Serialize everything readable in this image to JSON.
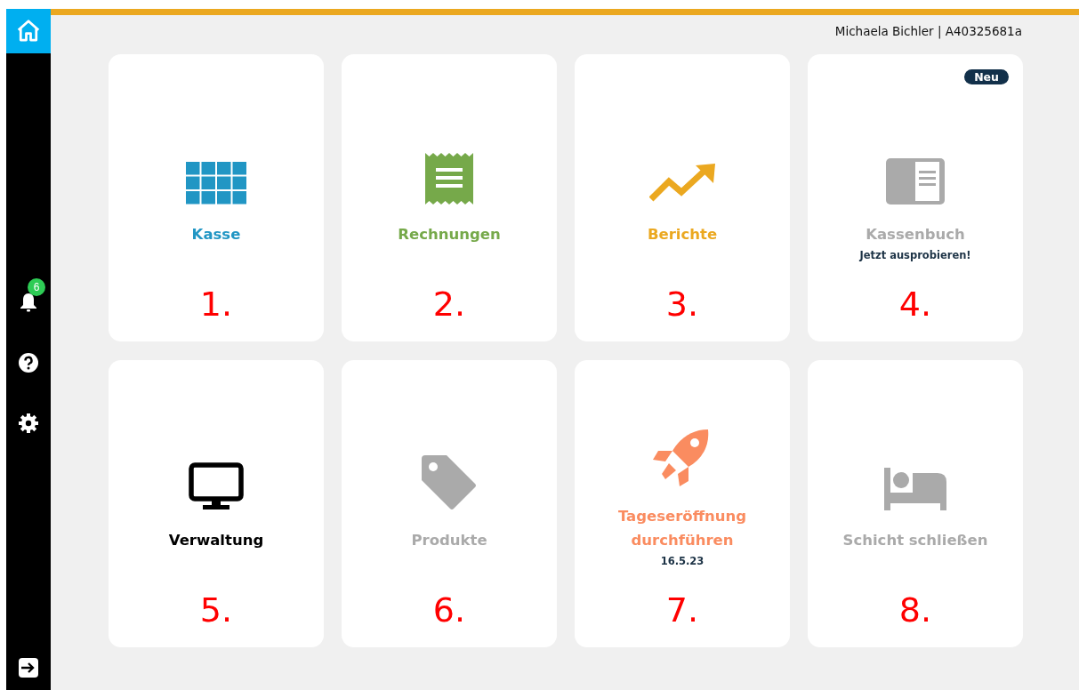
{
  "sidebar": {
    "items": [
      {
        "kind": "home",
        "selected": true
      },
      {
        "kind": "bell",
        "badge": "6",
        "selected": false
      },
      {
        "kind": "help",
        "selected": false
      },
      {
        "kind": "settings",
        "selected": false
      }
    ],
    "logout": {
      "kind": "logout"
    }
  },
  "header": {
    "user": "Michaela Bichler | A40325681a"
  },
  "tiles": [
    {
      "kind": "grid",
      "label": "Kasse",
      "color": "#2196c4",
      "annotation": "1."
    },
    {
      "kind": "receipt",
      "label": "Rechnungen",
      "color": "#76a94a",
      "annotation": "2."
    },
    {
      "kind": "chart",
      "label": "Berichte",
      "color": "#eba820",
      "annotation": "3."
    },
    {
      "kind": "book",
      "label": "Kassenbuch",
      "color": "#aaaaaa",
      "badge": "Neu",
      "subtitle": "Jetzt ausprobieren!",
      "annotation": "4."
    },
    {
      "kind": "monitor",
      "label": "Verwaltung",
      "color": "#000000",
      "annotation": "5."
    },
    {
      "kind": "tag",
      "label": "Produkte",
      "color": "#aaaaaa",
      "annotation": "6."
    },
    {
      "kind": "rocket",
      "label": "Tageseröffnung durchführen",
      "color": "#fa8c60",
      "subtitle": "16.5.23",
      "annotation": "7."
    },
    {
      "kind": "bed",
      "label": "Schicht schließen",
      "color": "#aaaaaa",
      "annotation": "8."
    }
  ]
}
